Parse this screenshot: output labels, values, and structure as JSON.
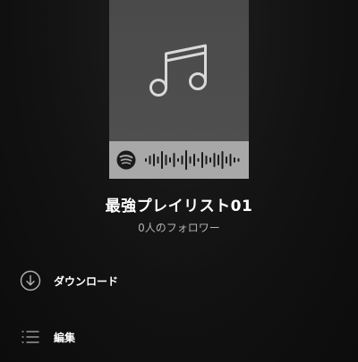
{
  "playlist": {
    "title": "最強プレイリスト01",
    "followers": "0人のフォロワー"
  },
  "cover": {
    "icon": "music-note-icon",
    "background_color": "#4d4d4d",
    "code_icon": "spotify-logo-icon",
    "code_bar_color": "#a8a8a8"
  },
  "actions": [
    {
      "label": "ダウンロード",
      "icon": "download-circle-icon"
    },
    {
      "label": "編集",
      "icon": "list-edit-icon"
    }
  ],
  "theme": {
    "background": "#121212",
    "text": "#ffffff",
    "subtext": "#b3b3b3"
  }
}
